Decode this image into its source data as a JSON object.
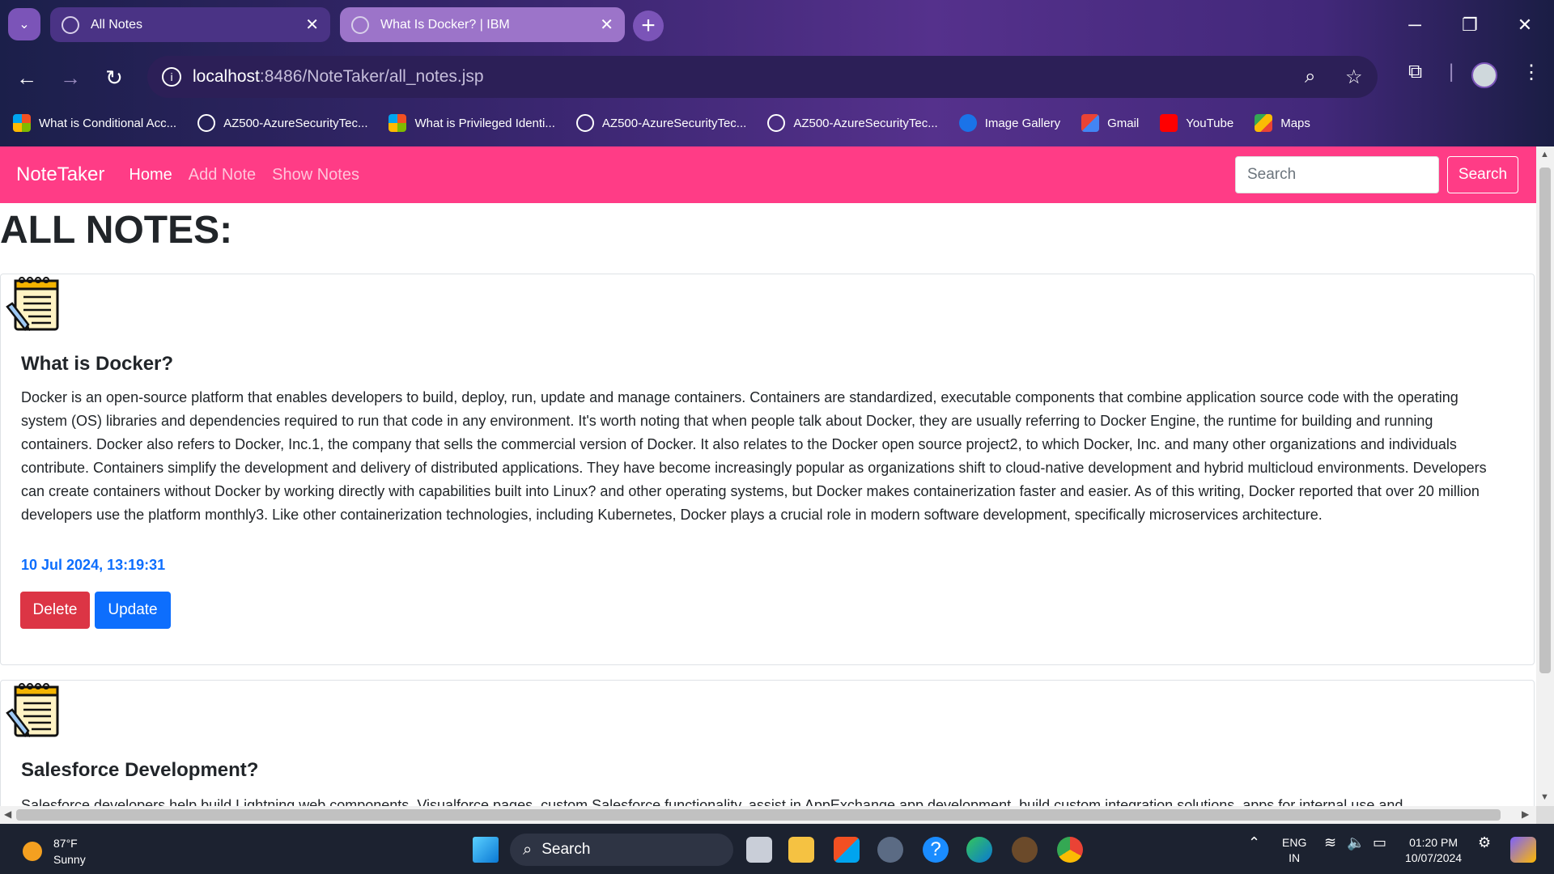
{
  "browser": {
    "tabs": [
      {
        "title": "All Notes",
        "active": true
      },
      {
        "title": "What Is Docker? | IBM",
        "active": false
      }
    ],
    "url_host": "localhost",
    "url_path": ":8486/NoteTaker/all_notes.jsp",
    "bookmarks": [
      {
        "label": "What is Conditional Acc...",
        "icon": "microsoft-icon"
      },
      {
        "label": "AZ500-AzureSecurityTec...",
        "icon": "globe-icon"
      },
      {
        "label": "What is Privileged Identi...",
        "icon": "microsoft-icon"
      },
      {
        "label": "AZ500-AzureSecurityTec...",
        "icon": "globe-icon"
      },
      {
        "label": "AZ500-AzureSecurityTec...",
        "icon": "globe-icon"
      },
      {
        "label": "Image Gallery",
        "icon": "drop-icon"
      },
      {
        "label": "Gmail",
        "icon": "gmail-icon"
      },
      {
        "label": "YouTube",
        "icon": "youtube-icon"
      },
      {
        "label": "Maps",
        "icon": "maps-icon"
      }
    ]
  },
  "app": {
    "brand": "NoteTaker",
    "nav": {
      "home": "Home",
      "add_note": "Add Note",
      "show_notes": "Show Notes"
    },
    "search": {
      "placeholder": "Search",
      "button": "Search"
    },
    "page_title": "ALL NOTES:",
    "notes": [
      {
        "title": "What is Docker?",
        "content": "Docker is an open-source platform that enables developers to build, deploy, run, update and manage containers. Containers are standardized, executable components that combine application source code with the operating system (OS) libraries and dependencies required to run that code in any environment. It's worth noting that when people talk about Docker, they are usually referring to Docker Engine, the runtime for building and running containers. Docker also refers to Docker, Inc.1, the company that sells the commercial version of Docker. It also relates to the Docker open source project2, to which Docker, Inc. and many other organizations and individuals contribute. Containers simplify the development and delivery of distributed applications. They have become increasingly popular as organizations shift to cloud-native development and hybrid multicloud environments. Developers can create containers without Docker by working directly with capabilities built into Linux? and other operating systems, but Docker makes containerization faster and easier. As of this writing, Docker reported that over 20 million developers use the platform monthly3. Like other containerization technologies, including Kubernetes, Docker plays a crucial role in modern software development, specifically microservices architecture.",
        "date": "10 Jul 2024, 13:19:31",
        "delete_label": "Delete",
        "update_label": "Update"
      },
      {
        "title": "Salesforce Development?",
        "content": "Salesforce developers help build Lightning web components, Visualforce pages, custom Salesforce functionality, assist in AppExchange app development, build custom integration solutions, apps for internal use and"
      }
    ]
  },
  "taskbar": {
    "weather_temp": "87°F",
    "weather_desc": "Sunny",
    "search_label": "Search",
    "lang_top": "ENG",
    "lang_bottom": "IN",
    "time": "01:20 PM",
    "date": "10/07/2024"
  },
  "colors": {
    "navbar": "#ff3c86",
    "date_blue": "#0d6efd",
    "delete_red": "#dc3545",
    "update_blue": "#0d6efd"
  }
}
